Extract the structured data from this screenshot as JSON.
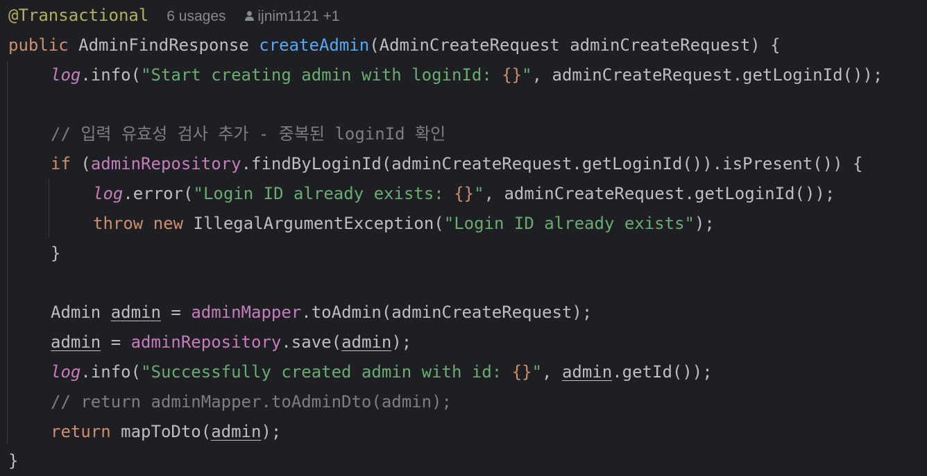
{
  "editor": {
    "annotation": "@Transactional",
    "usages": "6 usages",
    "author": "ijnim1121 +1",
    "decl": {
      "kw_public": "public",
      "return_type": "AdminFindResponse",
      "method_name": "createAdmin",
      "params": "(AdminCreateRequest adminCreateRequest) {"
    },
    "l3": {
      "log": "log",
      "call": ".info(",
      "str_a": "\"Start creating admin with loginId: ",
      "ph": "{}",
      "str_b": "\"",
      "rest": ", adminCreateRequest.getLoginId());"
    },
    "comment1": "// 입력 유효성 검사 추가 - 중복된 loginId 확인",
    "l6": {
      "kw_if": "if",
      "open": " (",
      "repo": "adminRepository",
      "rest": ".findByLoginId(adminCreateRequest.getLoginId()).isPresent()) {"
    },
    "l7": {
      "log": "log",
      "call": ".error(",
      "str_a": "\"Login ID already exists: ",
      "ph": "{}",
      "str_b": "\"",
      "rest": ", adminCreateRequest.getLoginId());"
    },
    "l8": {
      "kw_throw": "throw",
      "kw_new": "new",
      "cls": " IllegalArgumentException(",
      "str": "\"Login ID already exists\"",
      "rest": ");"
    },
    "close_if": "}",
    "l11": {
      "type": "Admin ",
      "var": "admin",
      "eq": " = ",
      "mapper": "adminMapper",
      "rest": ".toAdmin(adminCreateRequest);"
    },
    "l12": {
      "var": "admin",
      "eq": " = ",
      "repo": "adminRepository",
      "call": ".save(",
      "arg": "admin",
      "rest": ");"
    },
    "l13": {
      "log": "log",
      "call": ".info(",
      "str_a": "\"Successfully created admin with id: ",
      "ph": "{}",
      "str_b": "\"",
      "sep": ", ",
      "var": "admin",
      "rest": ".getId());"
    },
    "comment2": "// return adminMapper.toAdminDto(admin);",
    "l15": {
      "kw_return": "return",
      "call": " mapToDto(",
      "arg": "admin",
      "rest": ");"
    },
    "close_method": "}"
  },
  "colors": {
    "background": "#1e1f22",
    "keyword": "#cf8e6d",
    "string": "#6aab73",
    "field": "#c77dbb",
    "method_decl": "#56a8f5",
    "annotation": "#b3ae60",
    "comment": "#7a7e85",
    "text": "#bcbec4"
  }
}
